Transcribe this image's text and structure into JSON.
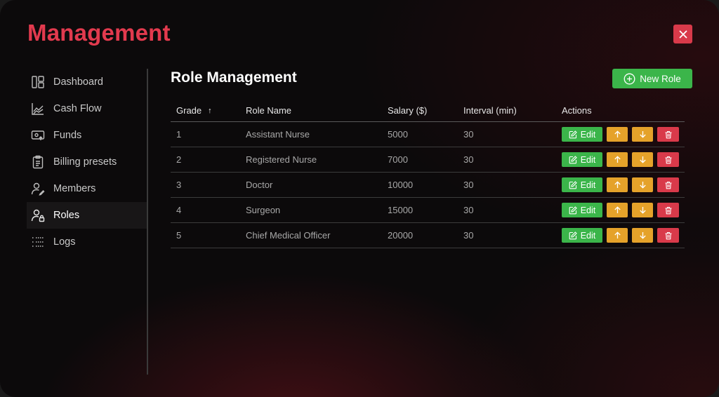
{
  "app": {
    "title": "Management"
  },
  "sidebar": {
    "items": [
      {
        "label": "Dashboard",
        "icon": "dashboard-icon",
        "active": false
      },
      {
        "label": "Cash Flow",
        "icon": "chart-icon",
        "active": false
      },
      {
        "label": "Funds",
        "icon": "funds-icon",
        "active": false
      },
      {
        "label": "Billing presets",
        "icon": "clipboard-icon",
        "active": false
      },
      {
        "label": "Members",
        "icon": "members-icon",
        "active": false
      },
      {
        "label": "Roles",
        "icon": "user-lock-icon",
        "active": true
      },
      {
        "label": "Logs",
        "icon": "list-icon",
        "active": false
      }
    ]
  },
  "main": {
    "title": "Role Management",
    "new_role_label": "New Role"
  },
  "table": {
    "columns": [
      "Grade",
      "Role Name",
      "Salary ($)",
      "Interval (min)",
      "Actions"
    ],
    "sort_indicator": "↑",
    "edit_label": "Edit",
    "rows": [
      {
        "grade": "1",
        "name": "Assistant Nurse",
        "salary": "5000",
        "interval": "30"
      },
      {
        "grade": "2",
        "name": "Registered Nurse",
        "salary": "7000",
        "interval": "30"
      },
      {
        "grade": "3",
        "name": "Doctor",
        "salary": "10000",
        "interval": "30"
      },
      {
        "grade": "4",
        "name": "Surgeon",
        "salary": "15000",
        "interval": "30"
      },
      {
        "grade": "5",
        "name": "Chief Medical Officer",
        "salary": "20000",
        "interval": "30"
      }
    ]
  },
  "colors": {
    "accent": "#e23a4e",
    "success": "#3bb54a",
    "warning": "#e5a22a",
    "danger": "#d93a4a"
  }
}
